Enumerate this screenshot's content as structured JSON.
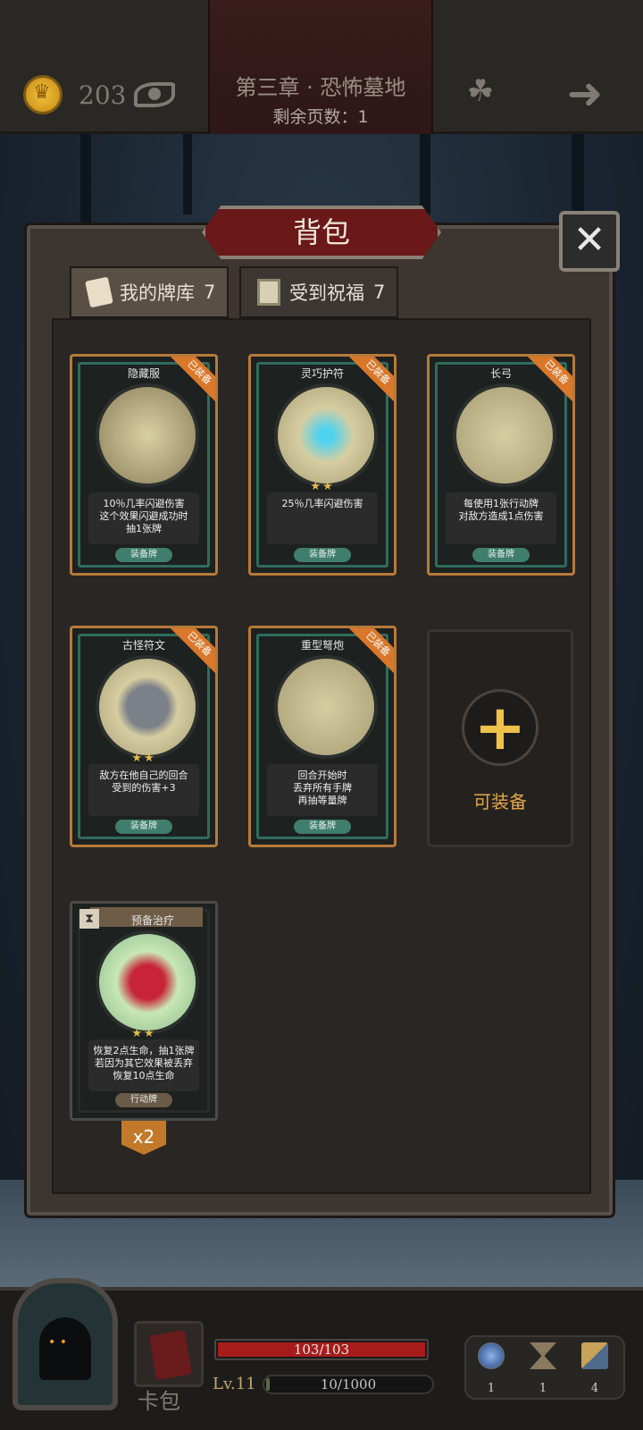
{
  "header": {
    "coins": "203",
    "chapter_title": "第三章 · 恐怖墓地",
    "pages_remaining": "剩余页数：1"
  },
  "panel": {
    "title": "背包",
    "tabs": [
      {
        "label": "我的牌库",
        "count": "7",
        "active": true
      },
      {
        "label": "受到祝福",
        "count": "7",
        "active": false
      }
    ]
  },
  "cards": [
    {
      "name": "隐藏服",
      "desc": "10％几率闪避伤害\n这个效果闪避成功时\n抽1张牌",
      "type": "装备牌",
      "equipped_badge": "已装备",
      "stars": ""
    },
    {
      "name": "灵巧护符",
      "desc": "25％几率闪避伤害",
      "type": "装备牌",
      "equipped_badge": "已装备",
      "stars": "★★"
    },
    {
      "name": "长弓",
      "desc": "每使用1张行动牌\n对敌方造成1点伤害",
      "type": "装备牌",
      "equipped_badge": "已装备",
      "stars": ""
    },
    {
      "name": "古怪符文",
      "desc": "敌方在他自己的回合\n受到的伤害+3",
      "type": "装备牌",
      "equipped_badge": "已装备",
      "stars": "★★"
    },
    {
      "name": "重型弩炮",
      "desc": "回合开始时\n丢弃所有手牌\n再抽等量牌",
      "type": "装备牌",
      "equipped_badge": "已装备",
      "stars": ""
    },
    {
      "name": "预备治疗",
      "desc": "恢复2点生命，抽1张牌\n若因为其它效果被丢弃\n恢复10点生命",
      "type": "行动牌",
      "stars": "★★",
      "multiplier": "x2"
    }
  ],
  "equip_slot": {
    "label": "可装备"
  },
  "player": {
    "hp": "103/103",
    "hp_fraction": 1.0,
    "level": "Lv.11",
    "xp": "10/1000",
    "xp_fraction": 0.01,
    "card_pack_label": "卡包"
  },
  "consumables": [
    {
      "icon": "potion-icon",
      "count": "1"
    },
    {
      "icon": "hourglass-icon",
      "count": "1"
    },
    {
      "icon": "cards-icon",
      "count": "4"
    }
  ]
}
